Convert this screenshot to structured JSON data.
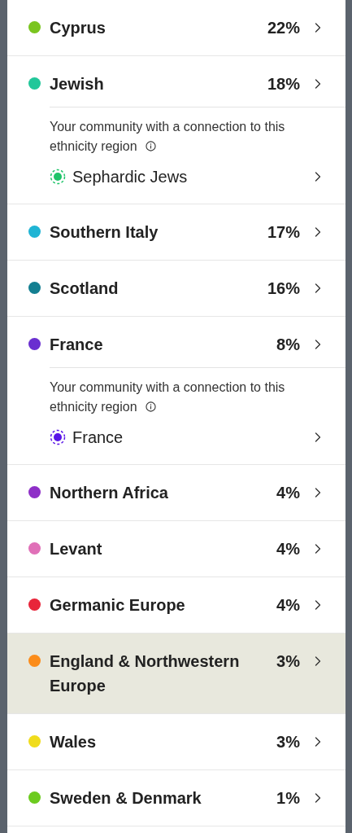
{
  "regions": [
    {
      "name": "Cyprus",
      "percent": "22%",
      "color": "#7ac51f",
      "selected": false
    },
    {
      "name": "Jewish",
      "percent": "18%",
      "color": "#22c79a",
      "selected": false,
      "community": {
        "label": "Your community with a connection to this ethnicity region",
        "name": "Sephardic Jews",
        "color": "#1fc46a"
      }
    },
    {
      "name": "Southern Italy",
      "percent": "17%",
      "color": "#1fb4d4",
      "selected": false
    },
    {
      "name": "Scotland",
      "percent": "16%",
      "color": "#137f91",
      "selected": false
    },
    {
      "name": "France",
      "percent": "8%",
      "color": "#6a2fd0",
      "selected": false,
      "community": {
        "label": "Your community with a connection to this ethnicity region",
        "name": "France",
        "color": "#5a16e8"
      }
    },
    {
      "name": "Northern Africa",
      "percent": "4%",
      "color": "#8e2fc7",
      "selected": false
    },
    {
      "name": "Levant",
      "percent": "4%",
      "color": "#e070b8",
      "selected": false
    },
    {
      "name": "Germanic Europe",
      "percent": "4%",
      "color": "#e8253a",
      "selected": false
    },
    {
      "name": "England & Northwestern Europe",
      "percent": "3%",
      "color": "#fb8c1a",
      "selected": true
    },
    {
      "name": "Wales",
      "percent": "3%",
      "color": "#f0dc1c",
      "selected": false
    },
    {
      "name": "Sweden & Denmark",
      "percent": "1%",
      "color": "#6ccb1f",
      "selected": false
    }
  ]
}
